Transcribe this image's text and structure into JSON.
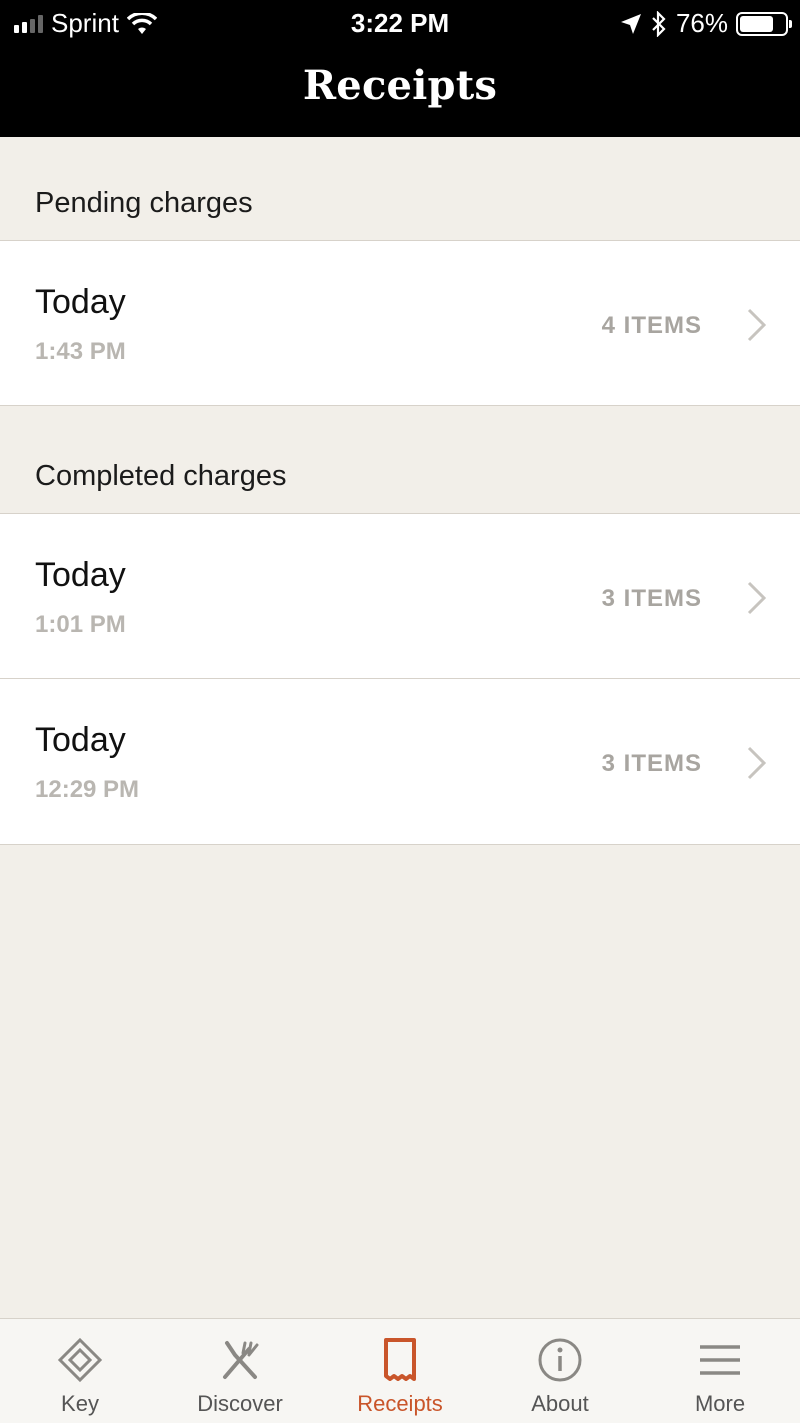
{
  "status_bar": {
    "carrier": "Sprint",
    "time": "3:22 PM",
    "battery_percent": "76%",
    "battery_level": 0.76,
    "icons": [
      "signal-icon",
      "wifi-icon",
      "location-arrow-icon",
      "bluetooth-icon",
      "battery-icon"
    ]
  },
  "header": {
    "title": "Receipts"
  },
  "sections": [
    {
      "title": "Pending charges",
      "rows": [
        {
          "date": "Today",
          "time": "1:43 PM",
          "count": "4 ITEMS"
        }
      ]
    },
    {
      "title": "Completed charges",
      "rows": [
        {
          "date": "Today",
          "time": "1:01 PM",
          "count": "3 ITEMS"
        },
        {
          "date": "Today",
          "time": "12:29 PM",
          "count": "3 ITEMS"
        }
      ]
    }
  ],
  "tabbar": {
    "tabs": [
      {
        "label": "Key",
        "icon": "key-diamond-icon"
      },
      {
        "label": "Discover",
        "icon": "utensils-icon"
      },
      {
        "label": "Receipts",
        "icon": "receipt-icon"
      },
      {
        "label": "About",
        "icon": "info-icon"
      },
      {
        "label": "More",
        "icon": "menu-icon"
      }
    ],
    "active": "Receipts"
  },
  "colors": {
    "accent": "#c9552a",
    "background": "#f2efe9",
    "header": "#000000"
  }
}
